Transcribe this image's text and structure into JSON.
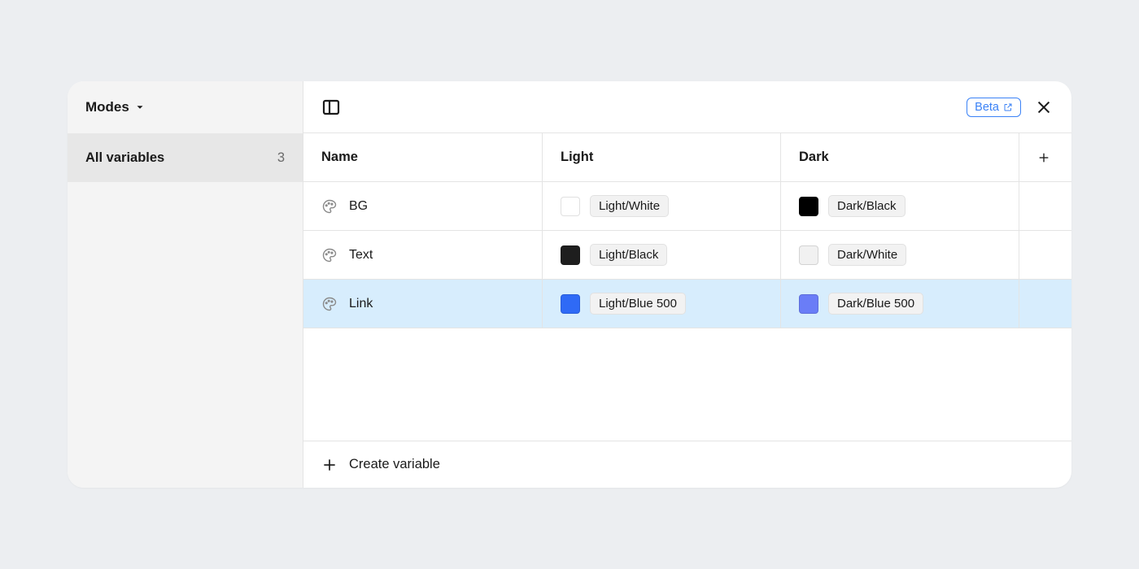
{
  "sidebar": {
    "title": "Modes",
    "collection": {
      "label": "All variables",
      "count": "3"
    }
  },
  "badge": {
    "label": "Beta"
  },
  "columns": {
    "name": "Name",
    "modes": [
      "Light",
      "Dark"
    ]
  },
  "rows": [
    {
      "name": "BG",
      "selected": false,
      "values": [
        {
          "label": "Light/White",
          "swatch": "#ffffff"
        },
        {
          "label": "Dark/Black",
          "swatch": "#000000"
        }
      ]
    },
    {
      "name": "Text",
      "selected": false,
      "values": [
        {
          "label": "Light/Black",
          "swatch": "#1e1e1e"
        },
        {
          "label": "Dark/White",
          "swatch": "#f1f1f1"
        }
      ]
    },
    {
      "name": "Link",
      "selected": true,
      "values": [
        {
          "label": "Light/Blue 500",
          "swatch": "#2f6af6"
        },
        {
          "label": "Dark/Blue 500",
          "swatch": "#6a7df7"
        }
      ]
    }
  ],
  "footer": {
    "create_label": "Create variable"
  }
}
